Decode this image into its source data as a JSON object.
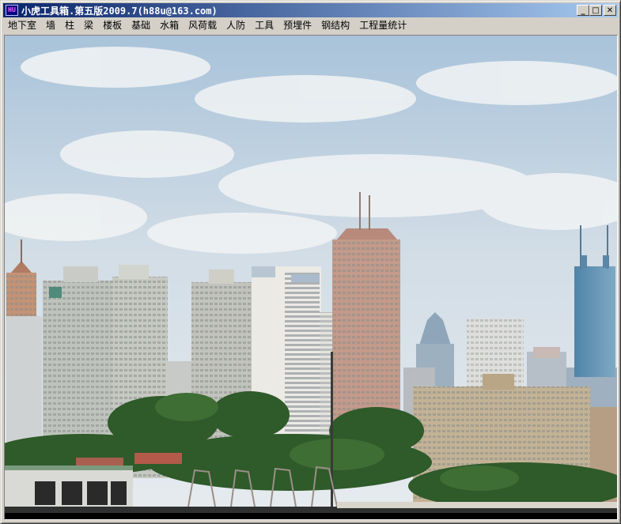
{
  "window": {
    "title": "小虎工具箱.第五版2009.7(h88u@163.com)",
    "icon_label": "HU",
    "controls": {
      "minimize": "_",
      "maximize": "□",
      "close": "✕"
    }
  },
  "menu": {
    "items": [
      {
        "id": "basement",
        "label": "地下室"
      },
      {
        "id": "wall",
        "label": "墙"
      },
      {
        "id": "column",
        "label": "柱"
      },
      {
        "id": "beam",
        "label": "梁"
      },
      {
        "id": "slab",
        "label": "楼板"
      },
      {
        "id": "foundation",
        "label": "基础"
      },
      {
        "id": "water-tank",
        "label": "水箱"
      },
      {
        "id": "wind-load",
        "label": "风荷载"
      },
      {
        "id": "civil-defense",
        "label": "人防"
      },
      {
        "id": "tools",
        "label": "工具"
      },
      {
        "id": "embedded-parts",
        "label": "预埋件"
      },
      {
        "id": "steel-structure",
        "label": "钢结构"
      },
      {
        "id": "quantity-stats",
        "label": "工程量统计"
      }
    ]
  },
  "content": {
    "image": "city-skyline-photo",
    "colors": {
      "sky_top": "#a9c3da",
      "sky_bottom": "#e6ebef",
      "trees": "#2f5a2a",
      "building_light": "#e8e6df",
      "building_pink": "#c49a8a",
      "building_blue": "#5d8fb0"
    }
  }
}
